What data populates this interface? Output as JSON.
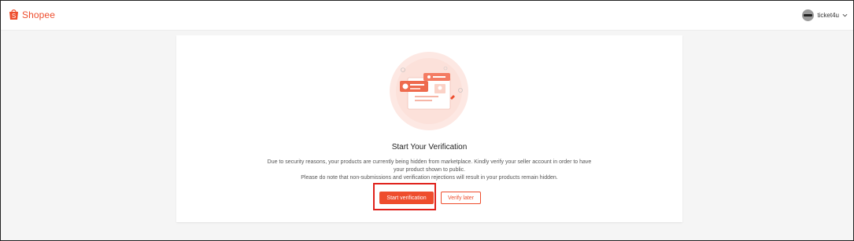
{
  "header": {
    "brand": "Shopee",
    "username": "ticket4u"
  },
  "verification": {
    "title": "Start Your Verification",
    "description_line1": "Due to security reasons, your products are currently being hidden from marketplace. Kindly verify your seller account in order to have",
    "description_line2": "your product shown to public.",
    "description_line3": "Please do note that non-submissions and verification rejections will result in your products remain hidden.",
    "start_button": "Start verification",
    "later_button": "Verify later"
  },
  "icons": {
    "brand": "shopee-bag-icon",
    "avatar": "user-avatar",
    "dropdown": "chevron-down-icon",
    "illustration": "verification-illustration"
  },
  "colors": {
    "brand": "#ee4d2d",
    "highlight": "#e0211b",
    "page_bg": "#f5f5f5"
  }
}
